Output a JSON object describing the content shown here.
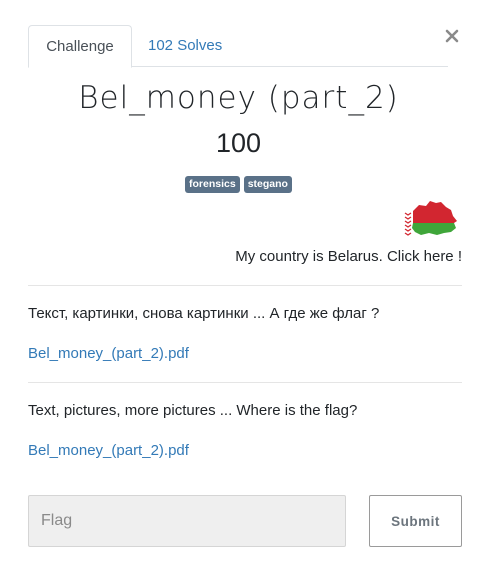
{
  "tabs": [
    {
      "label": "Challenge",
      "active": true
    },
    {
      "label": "102 Solves",
      "active": false
    }
  ],
  "close_icon": "close-icon",
  "challenge": {
    "name": "Bel_money (part_2)",
    "value": "100",
    "tags": [
      "forensics",
      "stegano"
    ],
    "country_link": "My country is Belarus. Click here !",
    "description_ru": "Текст, картинки, снова картинки ... А где же флаг ?",
    "file_1": "Bel_money_(part_2).pdf",
    "description_en": "Text, pictures, more pictures ... Where is the flag?",
    "file_2": "Bel_money_(part_2).pdf"
  },
  "form": {
    "placeholder": "Flag",
    "submit_label": "Submit"
  },
  "colors": {
    "link": "#337ab7",
    "tag_bg": "#5a7188",
    "belarus_red": "#d22630",
    "belarus_green": "#3fa63a"
  }
}
